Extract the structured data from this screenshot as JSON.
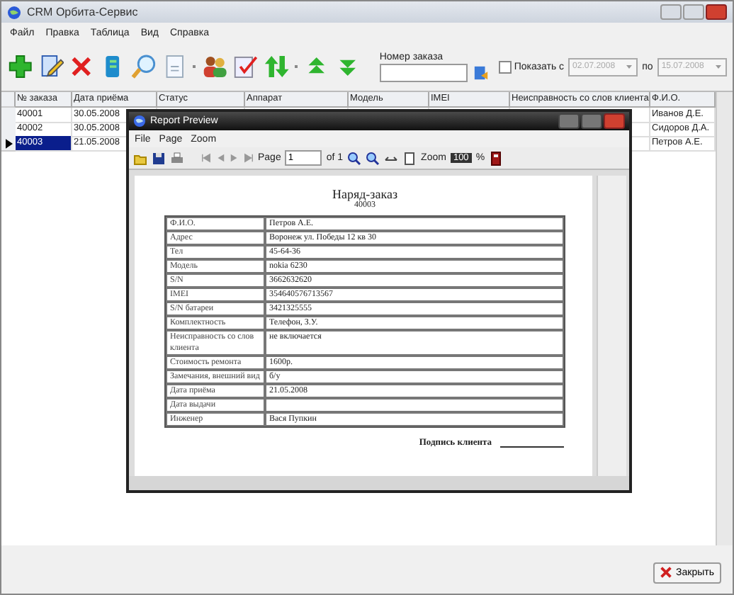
{
  "window": {
    "title": "CRM Орбита-Сервис"
  },
  "menu": [
    "Файл",
    "Правка",
    "Таблица",
    "Вид",
    "Справка"
  ],
  "order_search": {
    "label": "Номер заказа"
  },
  "date_filter": {
    "label": "Показать с",
    "checked": false,
    "from": "02.07.2008",
    "to_label": "по",
    "to": "15.07.2008",
    "disabled": true
  },
  "table": {
    "columns": [
      "№ заказа",
      "Дата приёма",
      "Статус",
      "Аппарат",
      "Модель",
      "IMEI",
      "Неисправность со слов клиента",
      "Ф.И.О."
    ],
    "rows": [
      {
        "order": "40001",
        "date": "30.05.2008",
        "name": "Иванов Д.Е.",
        "selected": false
      },
      {
        "order": "40002",
        "date": "30.05.2008",
        "name": "Сидоров Д.А.",
        "selected": false
      },
      {
        "order": "40003",
        "date": "21.05.2008",
        "name": "Петров А.Е.",
        "selected": true
      }
    ]
  },
  "report_window": {
    "title": "Report Preview",
    "menu": [
      "File",
      "Page",
      "Zoom"
    ],
    "page_label": "Page",
    "page": "1",
    "page_total": "of 1",
    "zoom_label": "Zoom",
    "zoom": "100",
    "zoom_unit": "%",
    "report": {
      "title": "Наряд-заказ",
      "number": "40003",
      "rows": [
        {
          "label": "Ф.И.О.",
          "value": "Петров А.Е."
        },
        {
          "label": "Адрес",
          "value": "Воронеж ул. Победы 12 кв 30"
        },
        {
          "label": "Тел",
          "value": "45-64-36"
        },
        {
          "label": "Модель",
          "value": "nokia 6230"
        },
        {
          "label": "S/N",
          "value": "3662632620"
        },
        {
          "label": "IMEI",
          "value": "354640576713567"
        },
        {
          "label": "S/N батареи",
          "value": "3421325555"
        },
        {
          "label": "Комплектность",
          "value": "Телефон, З.У."
        },
        {
          "label": "Неисправность со слов клиента",
          "value": "не включается"
        },
        {
          "label": "Стоимость ремонта",
          "value": "1600р."
        },
        {
          "label": "Замечания, внешний вид",
          "value": "б/у"
        },
        {
          "label": "Дата приёма",
          "value": "21.05.2008"
        },
        {
          "label": "Дата выдачи"
        },
        {
          "label": "Инженер",
          "value": "Вася Пупкин"
        }
      ],
      "signature": "Подпись клиента"
    }
  },
  "close_button": "Закрыть"
}
